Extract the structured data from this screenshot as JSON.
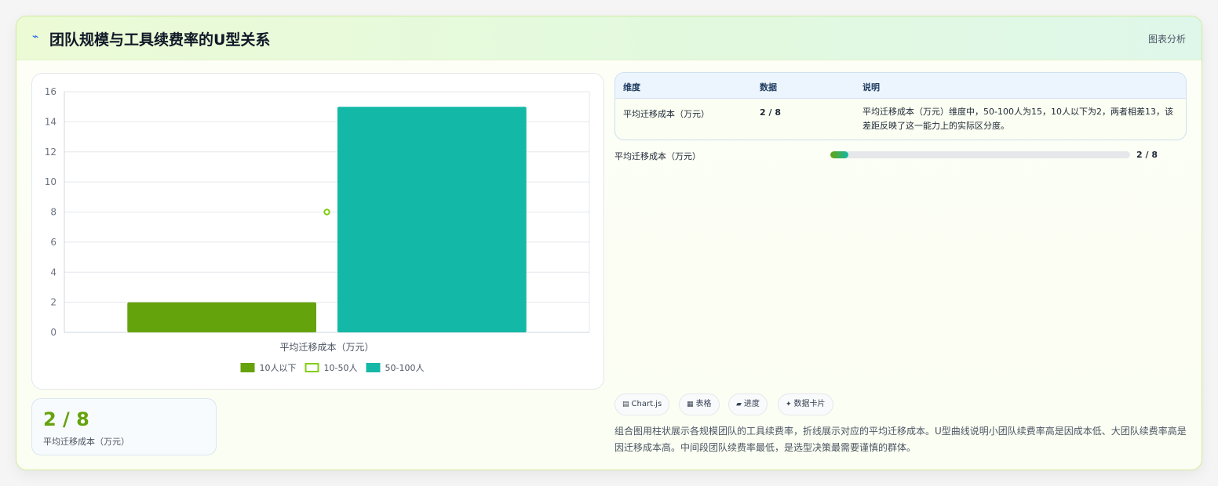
{
  "header": {
    "icon": "chart-icon",
    "title": "团队规模与工具续费率的U型关系",
    "tag": "图表分析"
  },
  "chart_data": {
    "type": "bar",
    "categories": [
      "平均迁移成本（万元）"
    ],
    "series": [
      {
        "name": "10人以下",
        "values": [
          2
        ],
        "color": "#65a30d",
        "style": "bar"
      },
      {
        "name": "10-50人",
        "values": [
          8
        ],
        "color": "#84cc16",
        "style": "line"
      },
      {
        "name": "50-100人",
        "values": [
          15
        ],
        "color": "#14b8a6",
        "style": "bar"
      }
    ],
    "ylim": [
      0,
      16
    ],
    "yticks": [
      "0",
      "2",
      "4",
      "6",
      "8",
      "10",
      "12",
      "14",
      "16"
    ],
    "xlabel": "平均迁移成本（万元）",
    "ylabel": "",
    "grid": true,
    "legend_position": "bottom"
  },
  "stat": {
    "value": "2 / 8",
    "label": "平均迁移成本（万元）"
  },
  "table": {
    "headers": [
      "维度",
      "数据",
      "说明"
    ],
    "rows": [
      {
        "dimension": "平均迁移成本（万元）",
        "data": "2 / 8",
        "note": "平均迁移成本（万元）维度中，50-100人为15，10人以下为2，两者相差13，该差距反映了这一能力上的实际区分度。"
      }
    ]
  },
  "progress": {
    "label": "平均迁移成本（万元）",
    "fraction": 0.06,
    "value_text": "2 / 8"
  },
  "chips": [
    {
      "icon": "▤",
      "label": "Chart.js"
    },
    {
      "icon": "▦",
      "label": "表格"
    },
    {
      "icon": "▰",
      "label": "进度"
    },
    {
      "icon": "✦",
      "label": "数据卡片"
    }
  ],
  "description": "组合图用柱状展示各规模团队的工具续费率，折线展示对应的平均迁移成本。U型曲线说明小团队续费率高是因成本低、大团队续费率高是因迁移成本高。中间段团队续费率最低，是选型决策最需要谨慎的群体。"
}
